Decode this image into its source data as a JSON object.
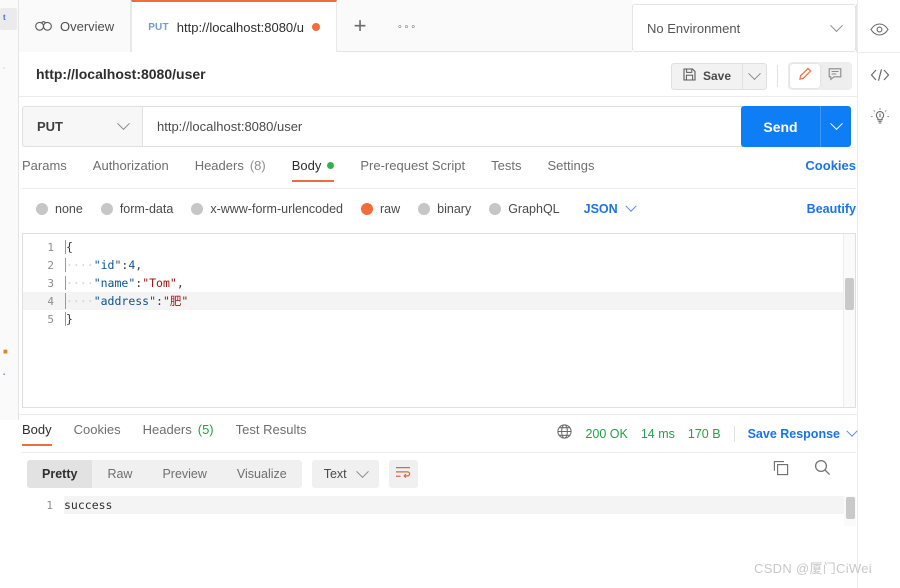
{
  "tabstrip": {
    "overview_label": "Overview",
    "overview_icon": "overview-glasses-icon",
    "request_tab": {
      "method": "PUT",
      "label": "http://localhost:8080/u",
      "unsaved": true
    },
    "new_tab_label": "+",
    "more_label": "∘∘∘"
  },
  "environment": {
    "selected": "No Environment",
    "eye_icon": "eye-icon"
  },
  "right_rail": {
    "code_icon": "code-brackets-icon",
    "bulb_icon": "lightbulb-icon"
  },
  "request": {
    "title": "http://localhost:8080/user",
    "save_label": "Save",
    "save_icon": "floppy-disk-icon",
    "edit_icon": "pencil-icon",
    "comment_icon": "comment-icon",
    "method": "PUT",
    "url": "http://localhost:8080/user",
    "send_label": "Send"
  },
  "request_tabs": {
    "items": [
      {
        "label": "Params",
        "active": false
      },
      {
        "label": "Authorization",
        "active": false
      },
      {
        "label": "Headers",
        "count": "(8)",
        "active": false
      },
      {
        "label": "Body",
        "active": true,
        "dot": true
      },
      {
        "label": "Pre-request Script",
        "active": false
      },
      {
        "label": "Tests",
        "active": false
      },
      {
        "label": "Settings",
        "active": false
      }
    ],
    "cookies_label": "Cookies"
  },
  "body_types": {
    "options": [
      {
        "label": "none",
        "selected": false
      },
      {
        "label": "form-data",
        "selected": false
      },
      {
        "label": "x-www-form-urlencoded",
        "selected": false
      },
      {
        "label": "raw",
        "selected": true
      },
      {
        "label": "binary",
        "selected": false
      },
      {
        "label": "GraphQL",
        "selected": false
      }
    ],
    "format": "JSON",
    "beautify_label": "Beautify"
  },
  "editor": {
    "lines": [
      {
        "num": "1",
        "indent": "",
        "content": "{",
        "type": "punct"
      },
      {
        "num": "2",
        "indent": "····",
        "key": "\"id\"",
        "colon": ":",
        "value": "4",
        "value_type": "num",
        "comma": ","
      },
      {
        "num": "3",
        "indent": "····",
        "key": "\"name\"",
        "colon": ":",
        "value": "\"Tom\"",
        "value_type": "str",
        "comma": ","
      },
      {
        "num": "4",
        "indent": "····",
        "key": "\"address\"",
        "colon": ":",
        "value": "\"肥\"",
        "value_type": "str",
        "comma": ""
      },
      {
        "num": "5",
        "indent": "",
        "content": "}",
        "type": "punct"
      }
    ]
  },
  "response_tabs": {
    "items": [
      {
        "label": "Body",
        "active": true
      },
      {
        "label": "Cookies",
        "active": false
      },
      {
        "label": "Headers",
        "count": "(5)",
        "active": false
      },
      {
        "label": "Test Results",
        "active": false
      }
    ],
    "globe_icon": "globe-icon",
    "status": "200 OK",
    "time": "14 ms",
    "size": "170 B",
    "save_response_label": "Save Response"
  },
  "response_toolbar": {
    "views": [
      {
        "label": "Pretty",
        "active": true
      },
      {
        "label": "Raw",
        "active": false
      },
      {
        "label": "Preview",
        "active": false
      },
      {
        "label": "Visualize",
        "active": false
      }
    ],
    "format": "Text",
    "wrap_icon": "word-wrap-icon",
    "copy_icon": "copy-icon",
    "search_icon": "search-icon"
  },
  "response_body": {
    "lines": [
      {
        "num": "1",
        "text": "success"
      }
    ]
  },
  "watermark": "CSDN @厦门CiWei",
  "colors": {
    "accent_orange": "#f26b3a",
    "send_blue": "#0d7ef5",
    "link_blue": "#1a73e8",
    "status_green": "#24a148"
  }
}
